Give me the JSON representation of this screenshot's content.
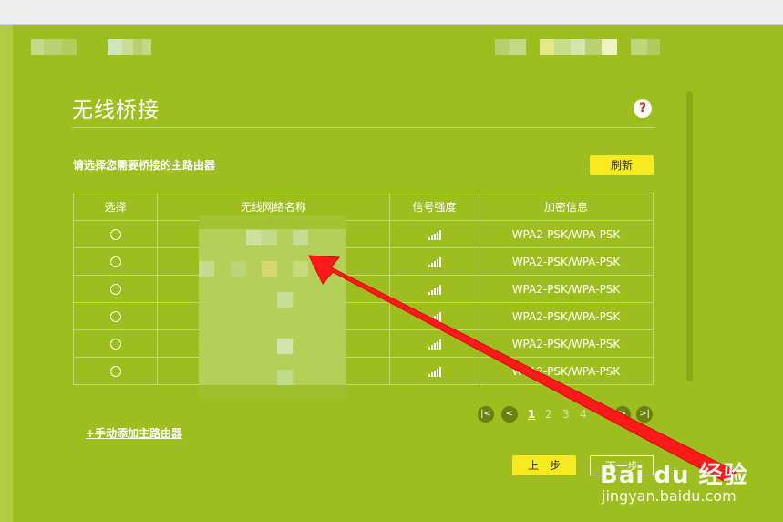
{
  "page": {
    "title": "无线桥接",
    "help": "?",
    "subtitle": "请选择您需要桥接的主路由器",
    "refresh_label": "刷新",
    "add_link": "+手动添加主路由器",
    "prev_label": "上一步",
    "next_label": "下一步"
  },
  "table": {
    "headers": [
      "选择",
      "无线网络名称",
      "信号强度",
      "加密信息"
    ],
    "rows": [
      {
        "ssid": "",
        "signal": "",
        "security": "WPA2-PSK/WPA-PSK"
      },
      {
        "ssid": "",
        "signal": "",
        "security": "WPA2-PSK/WPA-PSK"
      },
      {
        "ssid": "",
        "signal": "",
        "security": "WPA2-PSK/WPA-PSK"
      },
      {
        "ssid": "",
        "signal": "",
        "security": "WPA2-PSK/WPA-PSK"
      },
      {
        "ssid": "",
        "signal": "",
        "security": "WPA2-PSK/WPA-PSK"
      },
      {
        "ssid": "",
        "signal": "",
        "security": "WPA2-PSK/WPA-PSK"
      }
    ]
  },
  "pagination": {
    "pages": [
      "1",
      "2",
      "3",
      "4"
    ],
    "current": "1",
    "icons": [
      "first-page-icon",
      "prev-page-icon",
      "next-page-icon",
      "last-page-icon"
    ]
  },
  "watermark": {
    "logo": "Bai du 经验",
    "url": "jingyan.baidu.com"
  },
  "colors": {
    "background": "#9dbe1e",
    "button_yellow": "#f7ea1f",
    "arrow": "#ff0000"
  }
}
